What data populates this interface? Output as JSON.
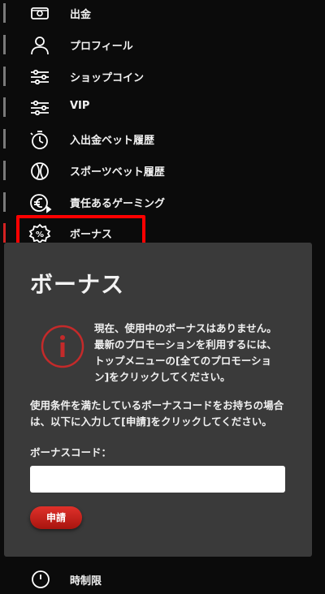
{
  "menu": {
    "items": [
      {
        "label": "出金",
        "icon": "withdraw-icon"
      },
      {
        "label": "プロフィール",
        "icon": "profile-icon"
      },
      {
        "label": "ショップコイン",
        "icon": "sliders-icon"
      },
      {
        "label": "VIP",
        "icon": "sliders-icon"
      },
      {
        "label": "入出金ベット履歴",
        "icon": "history-timer-icon"
      },
      {
        "label": "スポーツベット履歴",
        "icon": "ball-icon"
      },
      {
        "label": "責任あるゲーミング",
        "icon": "responsible-gaming-icon"
      },
      {
        "label": "ボーナス",
        "icon": "percent-icon",
        "active": true
      }
    ],
    "bottom_item_label": "時制限"
  },
  "bonus_panel": {
    "title": "ボーナス",
    "notice": "現在、使用中のボーナスはありません。 最新のプロモーションを利用するには、トップメニューの[全てのプロモーション]をクリックしてください。",
    "conditions": "使用条件を満たしているボーナスコードをお持ちの場合は、以下に入力して[申請]をクリックしてください。",
    "code_label": "ボーナスコード：",
    "code_value": "",
    "apply_label": "申請"
  },
  "colors": {
    "accent": "#d42222",
    "panel": "#3a3a3a",
    "highlight": "#ff0000"
  }
}
